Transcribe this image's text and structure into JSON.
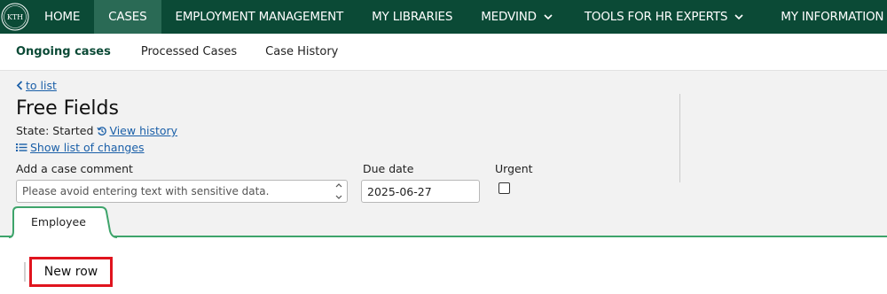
{
  "topnav": {
    "items": [
      {
        "label": "HOME"
      },
      {
        "label": "CASES"
      },
      {
        "label": "EMPLOYMENT MANAGEMENT"
      },
      {
        "label": "MY LIBRARIES"
      },
      {
        "label": "MEDVIND"
      },
      {
        "label": "TOOLS FOR HR EXPERTS"
      },
      {
        "label": "MY INFORMATION"
      }
    ],
    "active": "CASES",
    "logo_text": "KTH"
  },
  "subnav": {
    "items": [
      {
        "label": "Ongoing cases"
      },
      {
        "label": "Processed Cases"
      },
      {
        "label": "Case History"
      }
    ],
    "active": "Ongoing cases"
  },
  "case": {
    "back_link": "to list",
    "title": "Free Fields",
    "state_label": "State: Started",
    "view_history": "View history",
    "show_changes": "Show list of changes"
  },
  "form": {
    "comment_label": "Add a case comment",
    "comment_placeholder": "Please avoid entering text with sensitive data.",
    "comment_value": "",
    "due_date_label": "Due date",
    "due_date_value": "2025-06-27",
    "urgent_label": "Urgent",
    "urgent_checked": false
  },
  "tabs": [
    {
      "label": "Employee",
      "active": true
    }
  ],
  "content": {
    "new_row_label": "New row"
  },
  "colors": {
    "nav_bg": "#0b4a36",
    "nav_active": "#2a6a55",
    "accent_green": "#3ea46b",
    "link_blue": "#1a5fa8",
    "highlight_red": "#e0141e"
  }
}
